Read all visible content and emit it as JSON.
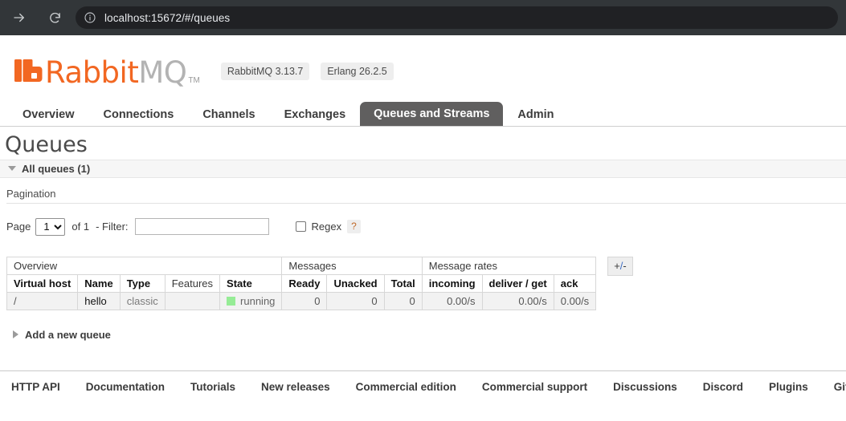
{
  "browser": {
    "url": "localhost:15672/#/queues",
    "forward_icon": "arrow-right-icon",
    "reload_icon": "reload-icon",
    "info_icon": "info-circle-icon"
  },
  "brand": {
    "logo_rabbit": "Rabbit",
    "logo_mq": "MQ",
    "trademark": "TM",
    "badges": [
      {
        "label": "RabbitMQ 3.13.7"
      },
      {
        "label": "Erlang 26.2.5"
      }
    ],
    "accent_color": "#f26722"
  },
  "nav": {
    "tabs": [
      {
        "label": "Overview",
        "active": false
      },
      {
        "label": "Connections",
        "active": false
      },
      {
        "label": "Channels",
        "active": false
      },
      {
        "label": "Exchanges",
        "active": false
      },
      {
        "label": "Queues and Streams",
        "active": true
      },
      {
        "label": "Admin",
        "active": false
      }
    ],
    "active_tab_color": "#605f5f"
  },
  "main": {
    "page_title": "Queues",
    "all_queues_label": "All queues (1)",
    "pagination": {
      "title": "Pagination",
      "page_label": "Page",
      "page_value": "1",
      "page_options": [
        "1"
      ],
      "of_label": "of 1",
      "filter_label": "- Filter:",
      "filter_value": "",
      "filter_placeholder": "",
      "regex_label": "Regex",
      "regex_checked": false,
      "help_label": "?"
    },
    "table": {
      "groups": [
        {
          "label": "Overview",
          "span": 5
        },
        {
          "label": "Messages",
          "span": 3
        },
        {
          "label": "Message rates",
          "span": 3
        }
      ],
      "columns": [
        {
          "label": "Virtual host",
          "sortable": true,
          "align": "left"
        },
        {
          "label": "Name",
          "sortable": true,
          "align": "left"
        },
        {
          "label": "Type",
          "sortable": true,
          "align": "left"
        },
        {
          "label": "Features",
          "sortable": false,
          "align": "left"
        },
        {
          "label": "State",
          "sortable": true,
          "align": "left"
        },
        {
          "label": "Ready",
          "sortable": true,
          "align": "right"
        },
        {
          "label": "Unacked",
          "sortable": true,
          "align": "right"
        },
        {
          "label": "Total",
          "sortable": true,
          "align": "right"
        },
        {
          "label": "incoming",
          "sortable": true,
          "align": "right"
        },
        {
          "label": "deliver / get",
          "sortable": true,
          "align": "right"
        },
        {
          "label": "ack",
          "sortable": true,
          "align": "right"
        }
      ],
      "rows": [
        {
          "virtual_host": "/",
          "name": "hello",
          "type": "classic",
          "features": "",
          "state": "running",
          "state_color": "#96ec96",
          "ready": "0",
          "unacked": "0",
          "total": "0",
          "incoming": "0.00/s",
          "deliver_get": "0.00/s",
          "ack": "0.00/s"
        }
      ],
      "columns_toggle_label": "+/-"
    },
    "add_queue_label": "Add a new queue"
  },
  "footer": {
    "links": [
      {
        "label": "HTTP API"
      },
      {
        "label": "Documentation"
      },
      {
        "label": "Tutorials"
      },
      {
        "label": "New releases"
      },
      {
        "label": "Commercial edition"
      },
      {
        "label": "Commercial support"
      },
      {
        "label": "Discussions"
      },
      {
        "label": "Discord"
      },
      {
        "label": "Plugins"
      },
      {
        "label": "GitHub"
      }
    ]
  }
}
